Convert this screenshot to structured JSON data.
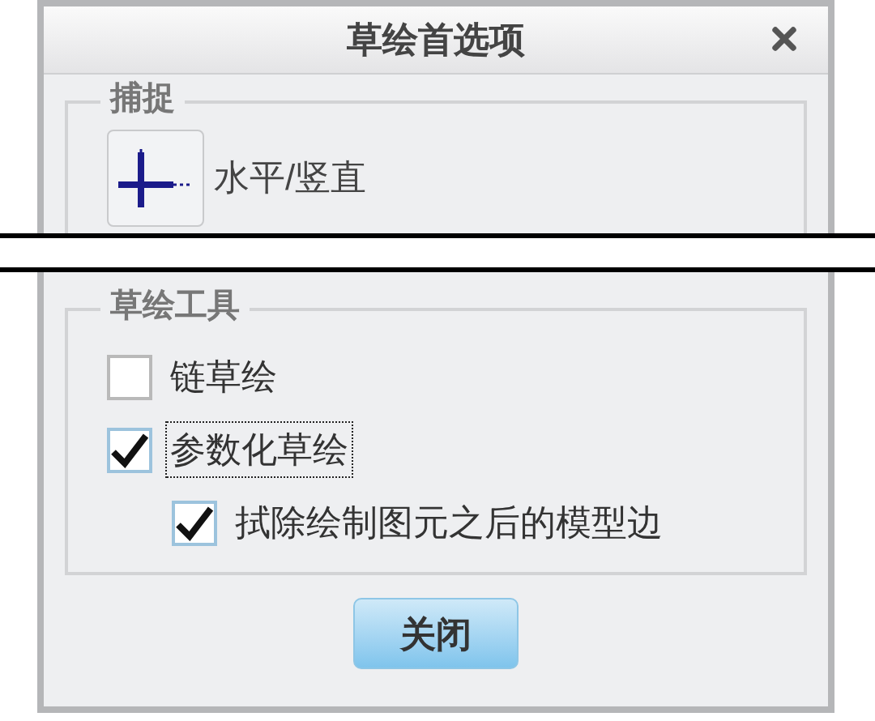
{
  "dialog": {
    "title": "草绘首选项"
  },
  "snap_group": {
    "legend": "捕捉",
    "items": [
      {
        "label": "水平/竖直"
      }
    ]
  },
  "tools_group": {
    "legend": "草绘工具",
    "options": [
      {
        "label": "链草绘",
        "checked": false,
        "focused": false
      },
      {
        "label": "参数化草绘",
        "checked": true,
        "focused": true,
        "children": [
          {
            "label": "拭除绘制图元之后的模型边",
            "checked": true,
            "focused": false
          }
        ]
      }
    ]
  },
  "buttons": [
    {
      "label": "关闭"
    }
  ]
}
